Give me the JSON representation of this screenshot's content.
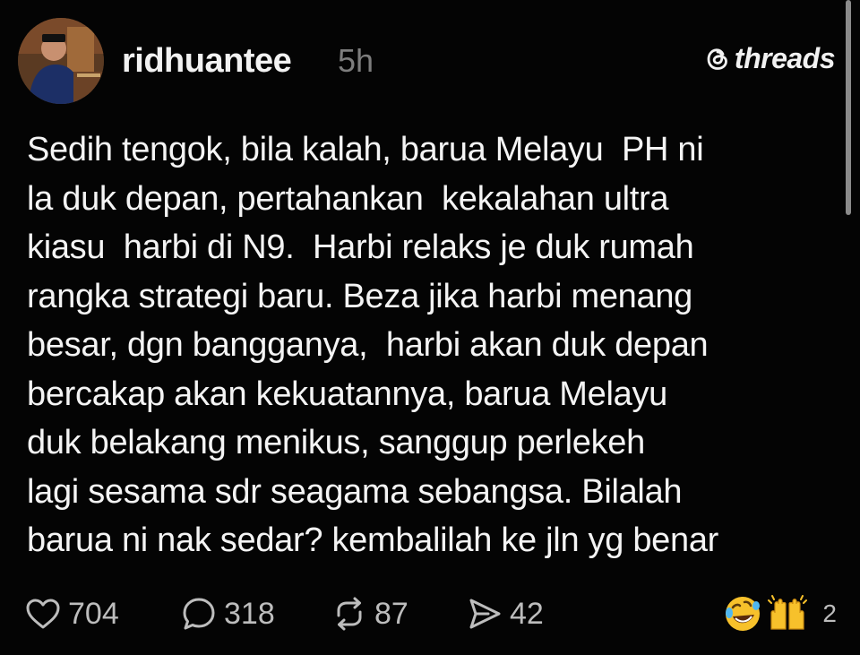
{
  "post": {
    "username": "ridhuantee",
    "timestamp": "5h",
    "brand": "threads",
    "body_lines": [
      "Sedih tengok, bila kalah, barua Melayu  PH ni",
      "la duk depan, pertahankan  kekalahan ultra",
      "kiasu  harbi di N9.  Harbi relaks je duk rumah",
      "rangka strategi baru. Beza jika harbi menang",
      "besar, dgn bangganya,  harbi akan duk depan",
      "bercakap akan kekuatannya, barua Melayu",
      "duk belakang menikus, sanggup perlekeh",
      "lagi sesama sdr seagama sebangsa. Bilalah",
      "barua ni nak sedar? kembalilah ke jln yg benar"
    ]
  },
  "actions": {
    "likes": "704",
    "comments": "318",
    "reposts": "87",
    "shares": "42",
    "reaction_count": "2"
  },
  "icons": {
    "like": "heart-icon",
    "comment": "comment-bubble-icon",
    "repost": "repost-icon",
    "share": "send-icon",
    "brand": "threads-logo-icon",
    "reactions": [
      "rofl-emoji",
      "raised-hands-emoji"
    ]
  },
  "colors": {
    "background": "#040404",
    "text": "#f4f4f4",
    "muted": "#7d7d7d",
    "action": "#bdbdbd"
  }
}
